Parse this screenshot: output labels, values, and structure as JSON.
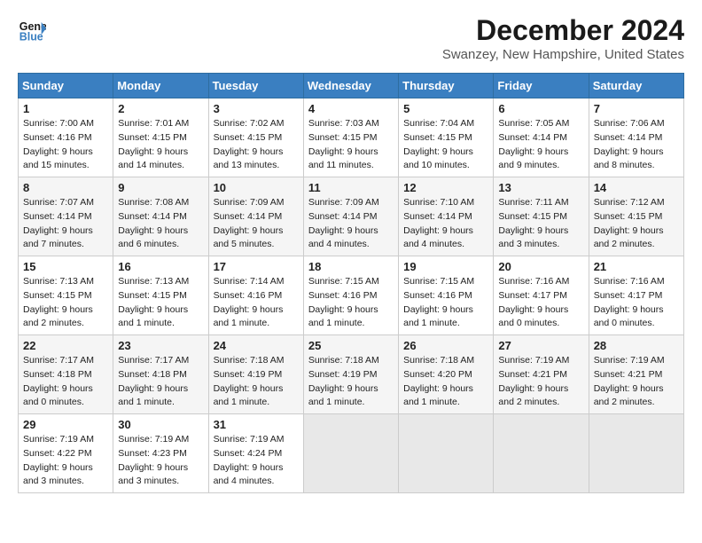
{
  "header": {
    "logo_line1": "General",
    "logo_line2": "Blue",
    "title": "December 2024",
    "location": "Swanzey, New Hampshire, United States"
  },
  "days_of_week": [
    "Sunday",
    "Monday",
    "Tuesday",
    "Wednesday",
    "Thursday",
    "Friday",
    "Saturday"
  ],
  "weeks": [
    [
      {
        "day": "1",
        "sunrise": "7:00 AM",
        "sunset": "4:16 PM",
        "daylight": "9 hours and 15 minutes."
      },
      {
        "day": "2",
        "sunrise": "7:01 AM",
        "sunset": "4:15 PM",
        "daylight": "9 hours and 14 minutes."
      },
      {
        "day": "3",
        "sunrise": "7:02 AM",
        "sunset": "4:15 PM",
        "daylight": "9 hours and 13 minutes."
      },
      {
        "day": "4",
        "sunrise": "7:03 AM",
        "sunset": "4:15 PM",
        "daylight": "9 hours and 11 minutes."
      },
      {
        "day": "5",
        "sunrise": "7:04 AM",
        "sunset": "4:15 PM",
        "daylight": "9 hours and 10 minutes."
      },
      {
        "day": "6",
        "sunrise": "7:05 AM",
        "sunset": "4:14 PM",
        "daylight": "9 hours and 9 minutes."
      },
      {
        "day": "7",
        "sunrise": "7:06 AM",
        "sunset": "4:14 PM",
        "daylight": "9 hours and 8 minutes."
      }
    ],
    [
      {
        "day": "8",
        "sunrise": "7:07 AM",
        "sunset": "4:14 PM",
        "daylight": "9 hours and 7 minutes."
      },
      {
        "day": "9",
        "sunrise": "7:08 AM",
        "sunset": "4:14 PM",
        "daylight": "9 hours and 6 minutes."
      },
      {
        "day": "10",
        "sunrise": "7:09 AM",
        "sunset": "4:14 PM",
        "daylight": "9 hours and 5 minutes."
      },
      {
        "day": "11",
        "sunrise": "7:09 AM",
        "sunset": "4:14 PM",
        "daylight": "9 hours and 4 minutes."
      },
      {
        "day": "12",
        "sunrise": "7:10 AM",
        "sunset": "4:14 PM",
        "daylight": "9 hours and 4 minutes."
      },
      {
        "day": "13",
        "sunrise": "7:11 AM",
        "sunset": "4:15 PM",
        "daylight": "9 hours and 3 minutes."
      },
      {
        "day": "14",
        "sunrise": "7:12 AM",
        "sunset": "4:15 PM",
        "daylight": "9 hours and 2 minutes."
      }
    ],
    [
      {
        "day": "15",
        "sunrise": "7:13 AM",
        "sunset": "4:15 PM",
        "daylight": "9 hours and 2 minutes."
      },
      {
        "day": "16",
        "sunrise": "7:13 AM",
        "sunset": "4:15 PM",
        "daylight": "9 hours and 1 minute."
      },
      {
        "day": "17",
        "sunrise": "7:14 AM",
        "sunset": "4:16 PM",
        "daylight": "9 hours and 1 minute."
      },
      {
        "day": "18",
        "sunrise": "7:15 AM",
        "sunset": "4:16 PM",
        "daylight": "9 hours and 1 minute."
      },
      {
        "day": "19",
        "sunrise": "7:15 AM",
        "sunset": "4:16 PM",
        "daylight": "9 hours and 1 minute."
      },
      {
        "day": "20",
        "sunrise": "7:16 AM",
        "sunset": "4:17 PM",
        "daylight": "9 hours and 0 minutes."
      },
      {
        "day": "21",
        "sunrise": "7:16 AM",
        "sunset": "4:17 PM",
        "daylight": "9 hours and 0 minutes."
      }
    ],
    [
      {
        "day": "22",
        "sunrise": "7:17 AM",
        "sunset": "4:18 PM",
        "daylight": "9 hours and 0 minutes."
      },
      {
        "day": "23",
        "sunrise": "7:17 AM",
        "sunset": "4:18 PM",
        "daylight": "9 hours and 1 minute."
      },
      {
        "day": "24",
        "sunrise": "7:18 AM",
        "sunset": "4:19 PM",
        "daylight": "9 hours and 1 minute."
      },
      {
        "day": "25",
        "sunrise": "7:18 AM",
        "sunset": "4:19 PM",
        "daylight": "9 hours and 1 minute."
      },
      {
        "day": "26",
        "sunrise": "7:18 AM",
        "sunset": "4:20 PM",
        "daylight": "9 hours and 1 minute."
      },
      {
        "day": "27",
        "sunrise": "7:19 AM",
        "sunset": "4:21 PM",
        "daylight": "9 hours and 2 minutes."
      },
      {
        "day": "28",
        "sunrise": "7:19 AM",
        "sunset": "4:21 PM",
        "daylight": "9 hours and 2 minutes."
      }
    ],
    [
      {
        "day": "29",
        "sunrise": "7:19 AM",
        "sunset": "4:22 PM",
        "daylight": "9 hours and 3 minutes."
      },
      {
        "day": "30",
        "sunrise": "7:19 AM",
        "sunset": "4:23 PM",
        "daylight": "9 hours and 3 minutes."
      },
      {
        "day": "31",
        "sunrise": "7:19 AM",
        "sunset": "4:24 PM",
        "daylight": "9 hours and 4 minutes."
      },
      null,
      null,
      null,
      null
    ]
  ]
}
